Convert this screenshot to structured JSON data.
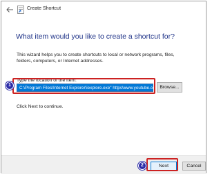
{
  "window": {
    "title": "Create Shortcut",
    "back_icon": "back-arrow-icon",
    "app_icon": "create-shortcut-icon"
  },
  "main": {
    "heading": "What item would you like to create a shortcut for?",
    "description": "This wizard helps you to create shortcuts to local or network programs, files, folders, computers, or Internet addresses.",
    "location_label": "Type the location of the item:",
    "location_value": "C:\\Program Files\\Internet Explorer\\iexplore.exe\" https\\www.youtube.com\"",
    "browse_label": "Browse...",
    "hint": "Click Next to continue."
  },
  "footer": {
    "next_label": "Next",
    "cancel_label": "Cancel"
  },
  "annotations": {
    "badge_1": "1",
    "badge_2": "2",
    "highlight_color": "#cc2222",
    "badge_color": "#2b2ba8"
  },
  "colors": {
    "heading": "#1e3287",
    "selection": "#0078d7",
    "footer_bg": "#f0f0f0"
  }
}
